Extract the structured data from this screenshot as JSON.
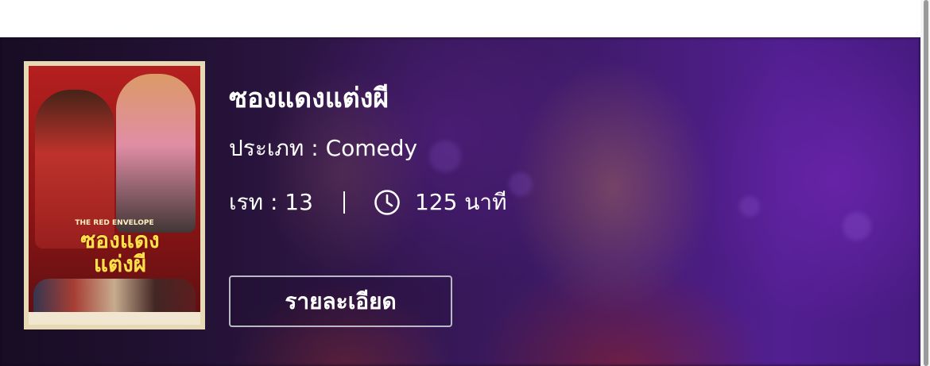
{
  "movie": {
    "title": "ซองแดงแต่งผี",
    "genre": "ประเภท : Comedy",
    "rating": "เรท : 13",
    "duration": "125 นาที",
    "details_button_label": "รายละเอียด",
    "poster": {
      "title_line1": "ซองแดง",
      "title_line2": "แต่งผี",
      "subtitle": "THE RED ENVELOPE"
    }
  },
  "icons": {
    "duration": "clock-icon"
  },
  "colors": {
    "banner_tint": "#4a1f7a",
    "text": "#ffffff",
    "button_border": "#b9b9c4",
    "poster_red": "#b51f1f",
    "poster_title": "#ffe24a"
  }
}
